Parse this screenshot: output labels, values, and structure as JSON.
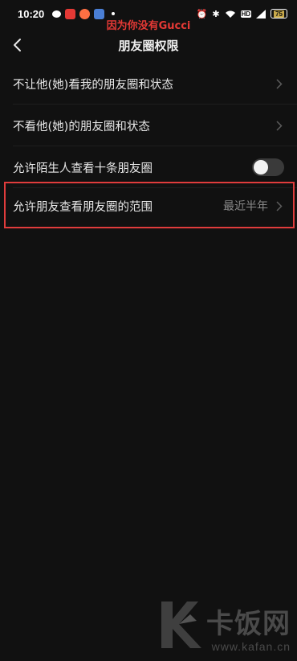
{
  "status_bar": {
    "time": "10:20",
    "network_label": "HD",
    "battery": "75",
    "icons": [
      "wechat-icon",
      "app-icon",
      "app-icon",
      "app-icon",
      "alarm-icon",
      "bluetooth-icon",
      "wifi-icon",
      "signal-icon"
    ]
  },
  "overlay_text": "因为你没有Gucci",
  "header": {
    "title": "朋友圈权限",
    "back_icon": "chevron-left-icon"
  },
  "rows": [
    {
      "label": "不让他(她)看我的朋友圈和状态",
      "type": "link"
    },
    {
      "label": "不看他(她)的朋友圈和状态",
      "type": "link"
    },
    {
      "label": "允许陌生人查看十条朋友圈",
      "type": "toggle",
      "on": false
    },
    {
      "label": "允许朋友查看朋友圈的范围",
      "type": "link",
      "value": "最近半年"
    }
  ],
  "watermark": {
    "title": "卡饭网",
    "url": "www.kafan.cn"
  },
  "colors": {
    "background": "#111111",
    "highlight": "#e03c3c",
    "overlay_text": "#e53935"
  }
}
